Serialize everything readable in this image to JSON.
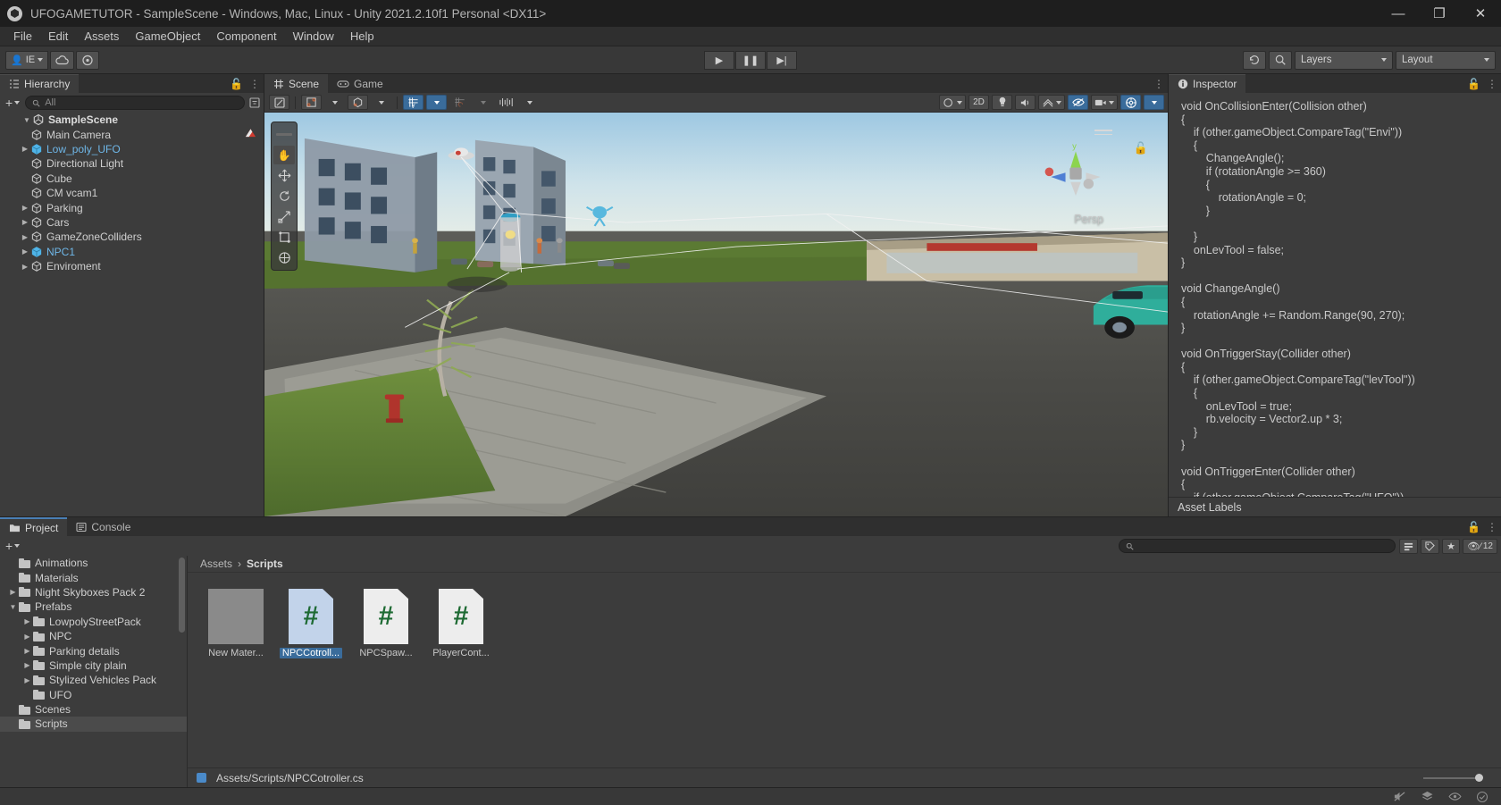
{
  "window": {
    "title": "UFOGAMETUTOR - SampleScene - Windows, Mac, Linux - Unity 2021.2.10f1 Personal <DX11>",
    "minimize": "—",
    "maximize": "❐",
    "close": "✕"
  },
  "menu": [
    "File",
    "Edit",
    "Assets",
    "GameObject",
    "Component",
    "Window",
    "Help"
  ],
  "toolbar": {
    "account_label": "IE",
    "cloud_icon": "cloud-icon",
    "collab_icon": "collab-icon",
    "play": "▶",
    "pause": "❚❚",
    "step": "▶|",
    "history_icon": "undo-history-icon",
    "search_icon": "search-icon",
    "layers_label": "Layers",
    "layout_label": "Layout"
  },
  "hierarchy": {
    "tab": "Hierarchy",
    "search_placeholder": "All",
    "add_label": "+",
    "lock_icon": "lock-icon",
    "menu_icon": "kebab-menu-icon",
    "scene_root": "SampleScene",
    "items": [
      {
        "label": "Main Camera",
        "indent": 1,
        "expandable": false,
        "prefab": false,
        "badge": "camera-preview-badge"
      },
      {
        "label": "Low_poly_UFO",
        "indent": 1,
        "expandable": true,
        "prefab": true
      },
      {
        "label": "Directional Light",
        "indent": 1,
        "expandable": false,
        "prefab": false
      },
      {
        "label": "Cube",
        "indent": 1,
        "expandable": false,
        "prefab": false
      },
      {
        "label": "CM vcam1",
        "indent": 1,
        "expandable": false,
        "prefab": false
      },
      {
        "label": "Parking",
        "indent": 1,
        "expandable": true,
        "prefab": false
      },
      {
        "label": "Cars",
        "indent": 1,
        "expandable": true,
        "prefab": false
      },
      {
        "label": "GameZoneColliders",
        "indent": 1,
        "expandable": true,
        "prefab": false
      },
      {
        "label": "NPC1",
        "indent": 1,
        "expandable": true,
        "prefab": true
      },
      {
        "label": "Enviroment",
        "indent": 1,
        "expandable": true,
        "prefab": false
      }
    ]
  },
  "scene": {
    "tabs": [
      {
        "label": "Scene",
        "icon": "scene-grid-icon",
        "active": true
      },
      {
        "label": "Game",
        "icon": "gamepad-icon",
        "active": false
      }
    ],
    "menu_icon": "kebab-menu-icon",
    "toolbar": {
      "shading_mode": "shaded-mode-dropdown",
      "draw_mode": "draw-mode-dropdown",
      "twod_label": "2D",
      "lighting_icon": "lighting-icon",
      "audio_icon": "audio-icon",
      "fx_icon": "effects-icon",
      "visibility_icon": "scene-visibility-icon",
      "camera_icon": "scene-camera-icon",
      "gizmos_icon": "gizmos-icon",
      "grid_icon": "grid-snap-icon",
      "move_snap_icon": "move-snap-icon"
    },
    "tools": [
      "hand-tool",
      "move-tool",
      "rotate-tool",
      "scale-tool",
      "rect-tool",
      "transform-tool"
    ],
    "gizmo_label": "Persp",
    "axis_y": "y",
    "lock_icon": "lock-icon"
  },
  "inspector": {
    "tab": "Inspector",
    "lock_icon": "lock-icon",
    "menu_icon": "kebab-menu-icon",
    "asset_labels_title": "Asset Labels",
    "code": "void OnCollisionEnter(Collision other)\n{\n    if (other.gameObject.CompareTag(\"Envi\"))\n    {\n        ChangeAngle();\n        if (rotationAngle >= 360)\n        {\n            rotationAngle = 0;\n        }\n\n    }\n    onLevTool = false;\n}\n\nvoid ChangeAngle()\n{\n    rotationAngle += Random.Range(90, 270);\n}\n\nvoid OnTriggerStay(Collider other)\n{\n    if (other.gameObject.CompareTag(\"levTool\"))\n    {\n        onLevTool = true;\n        rb.velocity = Vector2.up * 3;\n    }\n}\n\nvoid OnTriggerEnter(Collider other)\n{\n    if (other.gameObject.CompareTag(\"UFO\"))\n    {\n        Destroy(this.gameObject);\n        cam.GetComponent<NPCSpawner>().count--;\n    }\n}\n\nvoid GroundCheck()\n{\n    RaycastHit hit;\n    float distance = 0.1f;\n    Vector3 dir = Vector3.down;\n\n    if (Physics.Raycast(transform.position, dir, out hit, distance))"
  },
  "project": {
    "tabs": [
      {
        "label": "Project",
        "icon": "folder-icon",
        "active": true
      },
      {
        "label": "Console",
        "icon": "console-icon",
        "active": false
      }
    ],
    "lock_icon": "lock-icon",
    "menu_icon": "kebab-menu-icon",
    "add_label": "+",
    "search_placeholder": "",
    "search_icon": "search-icon",
    "filter_icons": [
      "search-by-type-icon",
      "search-by-label-icon",
      "favorites-star-icon"
    ],
    "hidden_count": "12",
    "hidden_icon": "hidden-items-icon",
    "tree": [
      {
        "label": "Animations",
        "indent": 1,
        "expandable": false,
        "open": false
      },
      {
        "label": "Materials",
        "indent": 1,
        "expandable": false,
        "open": false
      },
      {
        "label": "Night Skyboxes Pack 2",
        "indent": 1,
        "expandable": true,
        "open": false
      },
      {
        "label": "Prefabs",
        "indent": 1,
        "expandable": true,
        "open": true
      },
      {
        "label": "LowpolyStreetPack",
        "indent": 2,
        "expandable": true,
        "open": false
      },
      {
        "label": "NPC",
        "indent": 2,
        "expandable": true,
        "open": false
      },
      {
        "label": "Parking details",
        "indent": 2,
        "expandable": true,
        "open": false
      },
      {
        "label": "Simple city plain",
        "indent": 2,
        "expandable": true,
        "open": false
      },
      {
        "label": "Stylized Vehicles Pack",
        "indent": 2,
        "expandable": true,
        "open": false
      },
      {
        "label": "UFO",
        "indent": 2,
        "expandable": false,
        "open": false
      },
      {
        "label": "Scenes",
        "indent": 1,
        "expandable": false,
        "open": false
      },
      {
        "label": "Scripts",
        "indent": 1,
        "expandable": false,
        "open": false,
        "selected": true
      }
    ],
    "breadcrumb": [
      "Assets",
      "Scripts"
    ],
    "assets": [
      {
        "label": "New Mater...",
        "type": "material",
        "selected": false
      },
      {
        "label": "NPCCotroll...",
        "type": "csharp",
        "selected": true
      },
      {
        "label": "NPCSpaw...",
        "type": "csharp",
        "selected": false
      },
      {
        "label": "PlayerCont...",
        "type": "csharp",
        "selected": false
      }
    ],
    "status_path": "Assets/Scripts/NPCCotroller.cs"
  },
  "statusbar": {
    "icons": [
      "mute-audio-icon",
      "layers-stack-icon",
      "eye-icon",
      "check-circle-icon"
    ]
  }
}
